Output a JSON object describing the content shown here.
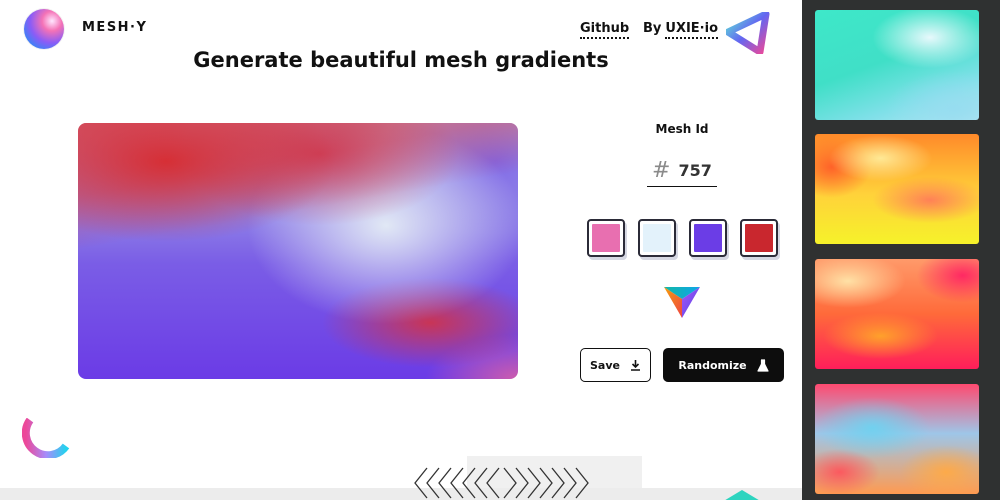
{
  "header": {
    "brand": "MESH·Y",
    "nav_github": "Github",
    "nav_by_prefix": "By",
    "nav_by_link": "UXIE·io"
  },
  "main": {
    "headline": "Generate beautiful mesh gradients",
    "mesh_id_label": "Mesh Id",
    "mesh_id_hash": "#",
    "mesh_id_value": "757",
    "swatches": [
      "#e86fb0",
      "#e3f2fb",
      "#6b3de6",
      "#c9272e"
    ],
    "save_label": "Save",
    "randomize_label": "Randomize"
  },
  "sidebar": {
    "cards": [
      "teal-mesh",
      "orange-yellow-mesh",
      "peach-red-mesh",
      "pink-blue-orange-mesh"
    ]
  },
  "colors": {
    "accent_dark": "#0d0d0d",
    "sidebar_bg": "#2f3131",
    "preview_red": "#d32f2f",
    "preview_purple": "#6b3be6"
  }
}
